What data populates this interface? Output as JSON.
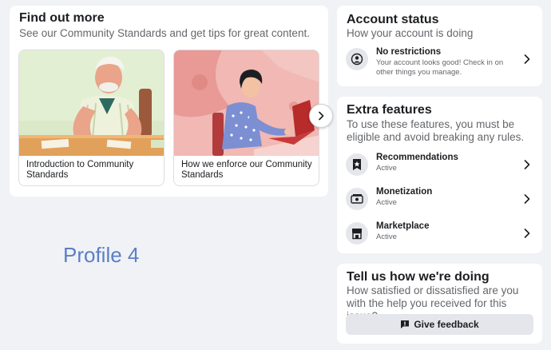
{
  "find_out_more": {
    "title": "Find out more",
    "subtitle": "See our Community Standards and get tips for great content.",
    "tiles": [
      {
        "label": "Introduction to Community Standards",
        "illustration": "man-at-table"
      },
      {
        "label": "How we enforce our Community Standards",
        "illustration": "woman-at-laptop"
      }
    ],
    "next_icon": "chevron-right-icon"
  },
  "profile_label": "Profile 4",
  "account_status": {
    "title": "Account status",
    "subtitle": "How your account is doing",
    "item": {
      "icon": "person-circle-icon",
      "title": "No restrictions",
      "description": "Your account looks good! Check in on other things you manage."
    }
  },
  "extra_features": {
    "title": "Extra features",
    "subtitle": "To use these features, you must be eligible and avoid breaking any rules.",
    "items": [
      {
        "icon": "star-badge-icon",
        "title": "Recommendations",
        "status": "Active"
      },
      {
        "icon": "money-icon",
        "title": "Monetization",
        "status": "Active"
      },
      {
        "icon": "storefront-icon",
        "title": "Marketplace",
        "status": "Active"
      }
    ]
  },
  "tell_us": {
    "title": "Tell us how we're doing",
    "subtitle": "How satisfied or dissatisfied are you with the help you received for this issue?",
    "button_label": "Give feedback",
    "button_icon": "feedback-icon"
  },
  "colors": {
    "background": "#f0f2f5",
    "card": "#ffffff",
    "secondary_text": "#65676b",
    "button_bg": "#e4e6eb",
    "profile_label": "#5b7ec8"
  }
}
